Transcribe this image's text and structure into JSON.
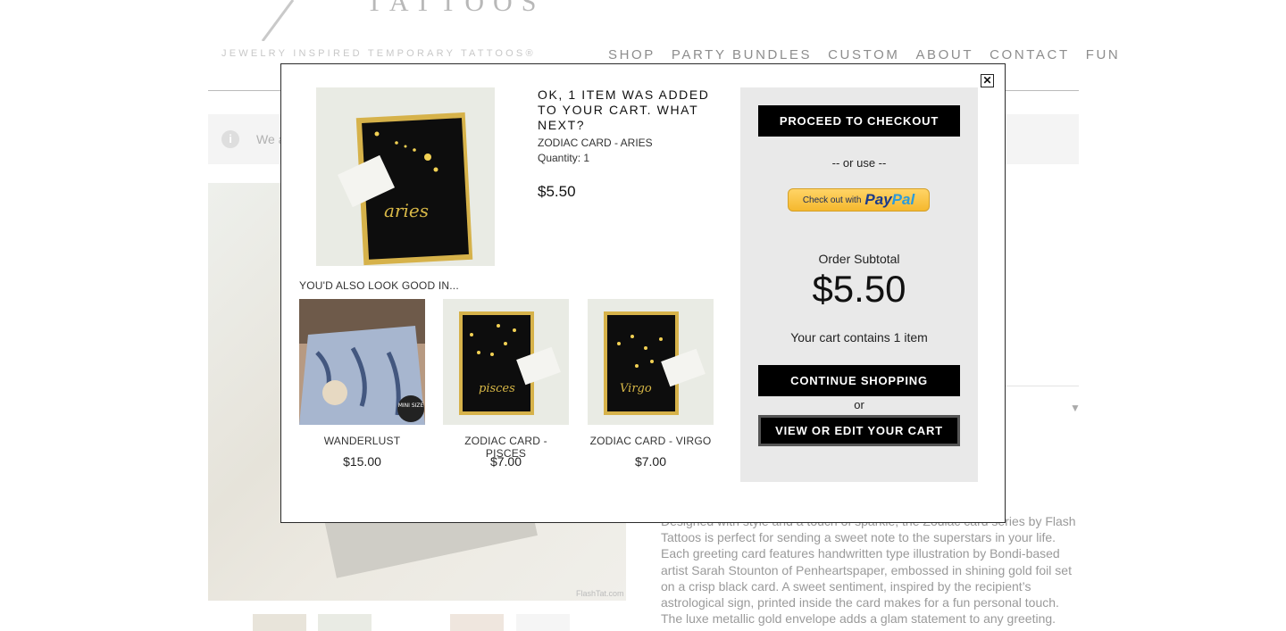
{
  "header": {
    "logo_word": "TATTOOS",
    "tagline": "JEWELRY INSPIRED TEMPORARY TATTOOS®",
    "nav": [
      "SHOP",
      "PARTY BUNDLES",
      "CUSTOM",
      "ABOUT",
      "CONTACT",
      "FUN"
    ]
  },
  "notice": {
    "icon": "info-icon",
    "text": "We a"
  },
  "hero": {
    "caption": "FlashTat.com"
  },
  "description": "Designed with style and a touch of sparkle, the Zodiac card series by Flash Tattoos is perfect for sending a sweet note to the superstars in your life. Each greeting card features handwritten type illustration by Bondi-based artist Sarah Stounton of Penheartspaper, embossed in shining gold foil set on a crisp black card. A sweet sentiment, inspired by the recipient’s astrological sign, printed inside the card makes for a fun personal touch. The luxe metallic gold envelope adds a glam statement to any greeting.",
  "modal": {
    "close_label": "✕",
    "added_title": "OK, 1 ITEM WAS ADDED TO YOUR CART. WHAT NEXT?",
    "product_name": "ZODIAC CARD - ARIES",
    "quantity_label": "Quantity: 1",
    "product_price": "$5.50",
    "product_script": "aries",
    "also_title": "YOU'D ALSO LOOK GOOD IN...",
    "recommendations": [
      {
        "name": "WANDERLUST",
        "price": "$15.00",
        "badge": "MINI SIZE"
      },
      {
        "name": "ZODIAC CARD - PISCES",
        "price": "$7.00",
        "script": "pisces"
      },
      {
        "name": "ZODIAC CARD - VIRGO",
        "price": "$7.00",
        "script": "Virgo"
      }
    ],
    "checkout_label": "PROCEED TO CHECKOUT",
    "or_use": "-- or use --",
    "paypal_small": "Check out with",
    "paypal_pay": "Pay",
    "paypal_pal": "Pal",
    "subtotal_label": "Order Subtotal",
    "subtotal_value": "$5.50",
    "cart_count": "Your cart contains 1 item",
    "continue_label": "CONTINUE SHOPPING",
    "or_label": "or",
    "view_cart_label": "VIEW OR EDIT YOUR CART"
  },
  "colors": {
    "accent": "#000000",
    "paypal": "#f5b82e",
    "gold": "#d4b030"
  }
}
